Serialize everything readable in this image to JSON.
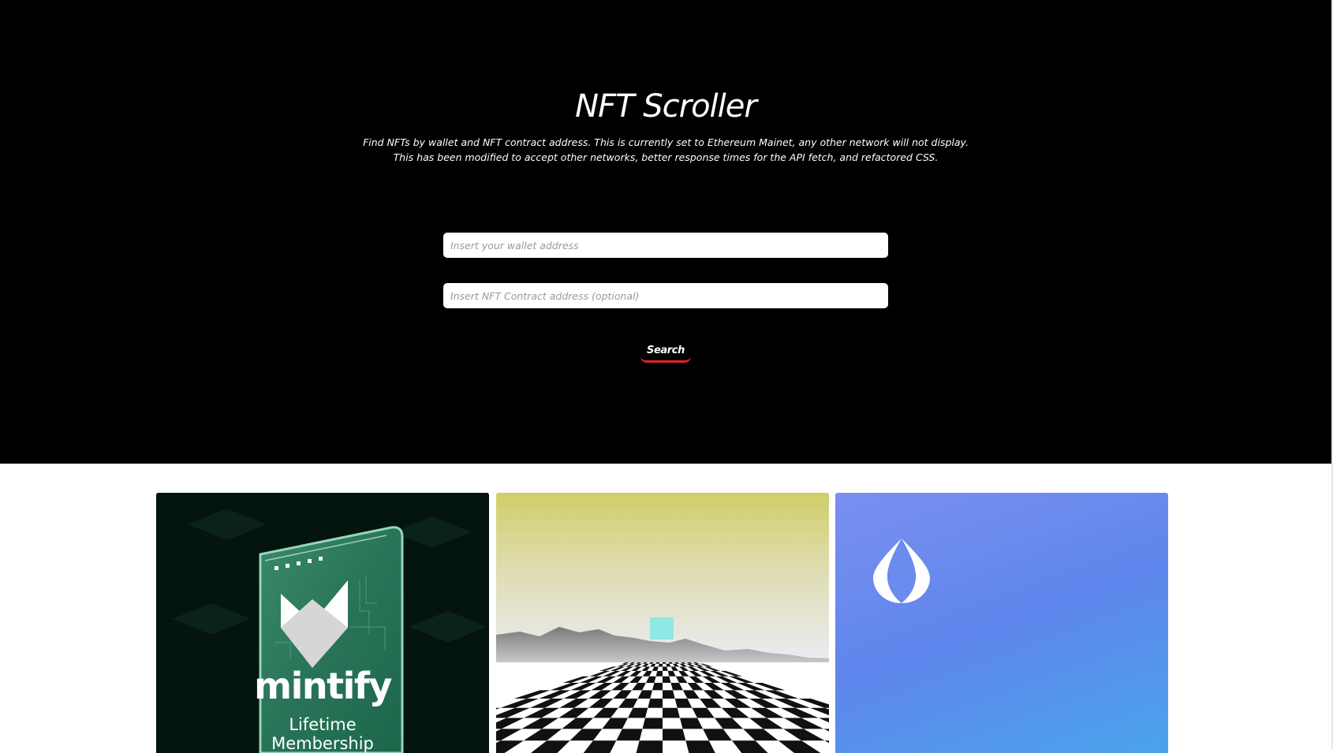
{
  "page": {
    "title": "NFT Scroller",
    "description": [
      "Find NFTs by wallet and NFT contract address. This is currently set to Ethereum Mainet, any other network will not display.",
      "This has been modified to accept other networks, better response times for the API fetch, and refactored CSS."
    ]
  },
  "form": {
    "wallet_placeholder": "Insert your wallet address",
    "contract_placeholder": "Insert NFT Contract address (optional)",
    "search_label": "Search"
  },
  "colors": {
    "hero_background": "#000000",
    "button_underline": "#e02424"
  },
  "nfts": [
    {
      "image": "mintify-membership-card",
      "brand": "mintify",
      "lines": [
        "Lifetime",
        "Membership"
      ]
    },
    {
      "image": "checkerboard-landscape-cube"
    },
    {
      "image": "ens-logo-gradient"
    }
  ]
}
